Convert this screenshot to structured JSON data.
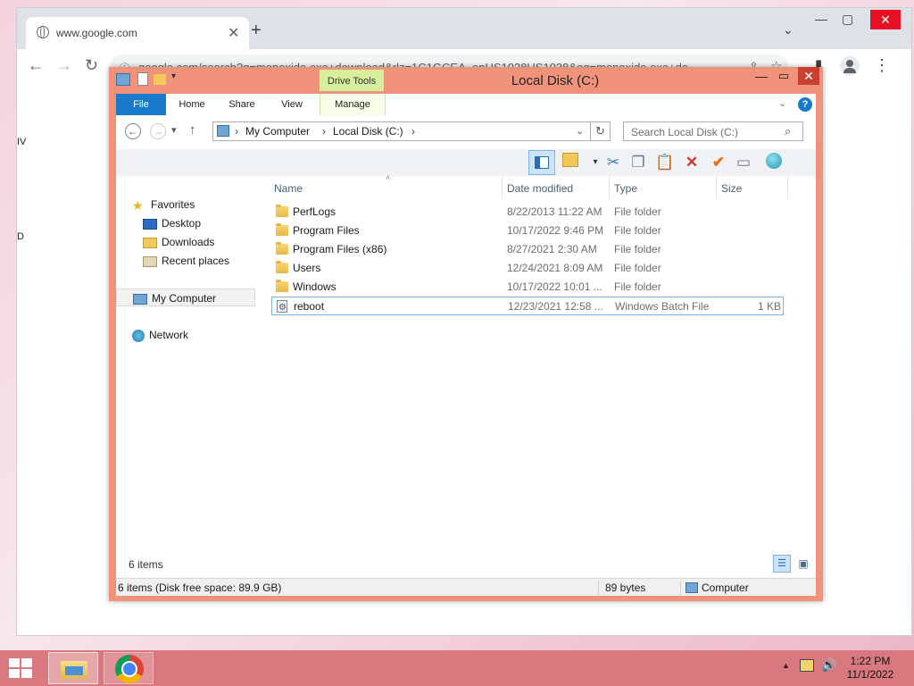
{
  "browser": {
    "tab_title": "www.google.com",
    "tab_close": "✕",
    "new_tab": "+",
    "tab_search": "⌄",
    "minimize": "—",
    "maximize": "▢",
    "close": "✕",
    "back": "←",
    "forward": "→",
    "reload": "↻",
    "site_info": "ⓘ",
    "url": "google.com/search?q=monoxide.exe+download&rlz=1C1GCEA_enUS1028US1028&oq=monoxide.exe+do",
    "share": "⇪",
    "star": "☆",
    "sidepanel": "▮",
    "menu": "⋮",
    "page_fragment_1": "IV",
    "page_fragment_2": "D"
  },
  "explorer": {
    "window_title": "Local Disk (C:)",
    "drive_tools_label": "Drive Tools",
    "ribbon_tabs": [
      "File",
      "Home",
      "Share",
      "View",
      "Manage"
    ],
    "ribbon_help": "?",
    "ribbon_expand": "⌄",
    "nav_back": "←",
    "nav_forward": "→",
    "nav_recent": "▾",
    "nav_up": "↑",
    "breadcrumb": [
      "My Computer",
      "Local Disk (C:)"
    ],
    "breadcrumb_sep": "›",
    "address_dropdown": "⌄",
    "refresh": "↻",
    "search_placeholder": "Search Local Disk (C:)",
    "search_icon": "⌕",
    "nav_pane": {
      "favorites": "Favorites",
      "favorites_items": [
        "Desktop",
        "Downloads",
        "Recent places"
      ],
      "my_computer": "My Computer",
      "network": "Network"
    },
    "columns": [
      "Name",
      "Date modified",
      "Type",
      "Size"
    ],
    "files": [
      {
        "name": "PerfLogs",
        "date": "8/22/2013 11:22 AM",
        "type": "File folder",
        "size": "",
        "kind": "folder"
      },
      {
        "name": "Program Files",
        "date": "10/17/2022 9:46 PM",
        "type": "File folder",
        "size": "",
        "kind": "folder"
      },
      {
        "name": "Program Files (x86)",
        "date": "8/27/2021 2:30 AM",
        "type": "File folder",
        "size": "",
        "kind": "folder"
      },
      {
        "name": "Users",
        "date": "12/24/2021 8:09 AM",
        "type": "File folder",
        "size": "",
        "kind": "folder"
      },
      {
        "name": "Windows",
        "date": "10/17/2022 10:01 ...",
        "type": "File folder",
        "size": "",
        "kind": "folder"
      },
      {
        "name": "reboot",
        "date": "12/23/2021 12:58 ...",
        "type": "Windows Batch File",
        "size": "1 KB",
        "kind": "batch"
      }
    ],
    "items_count": "6 items",
    "status": {
      "summary": "6 items (Disk free space: 89.9 GB)",
      "bytes": "89 bytes",
      "location": "Computer"
    }
  },
  "taskbar": {
    "time": "1:22 PM",
    "date": "11/1/2022",
    "tray_expand": "▲"
  }
}
